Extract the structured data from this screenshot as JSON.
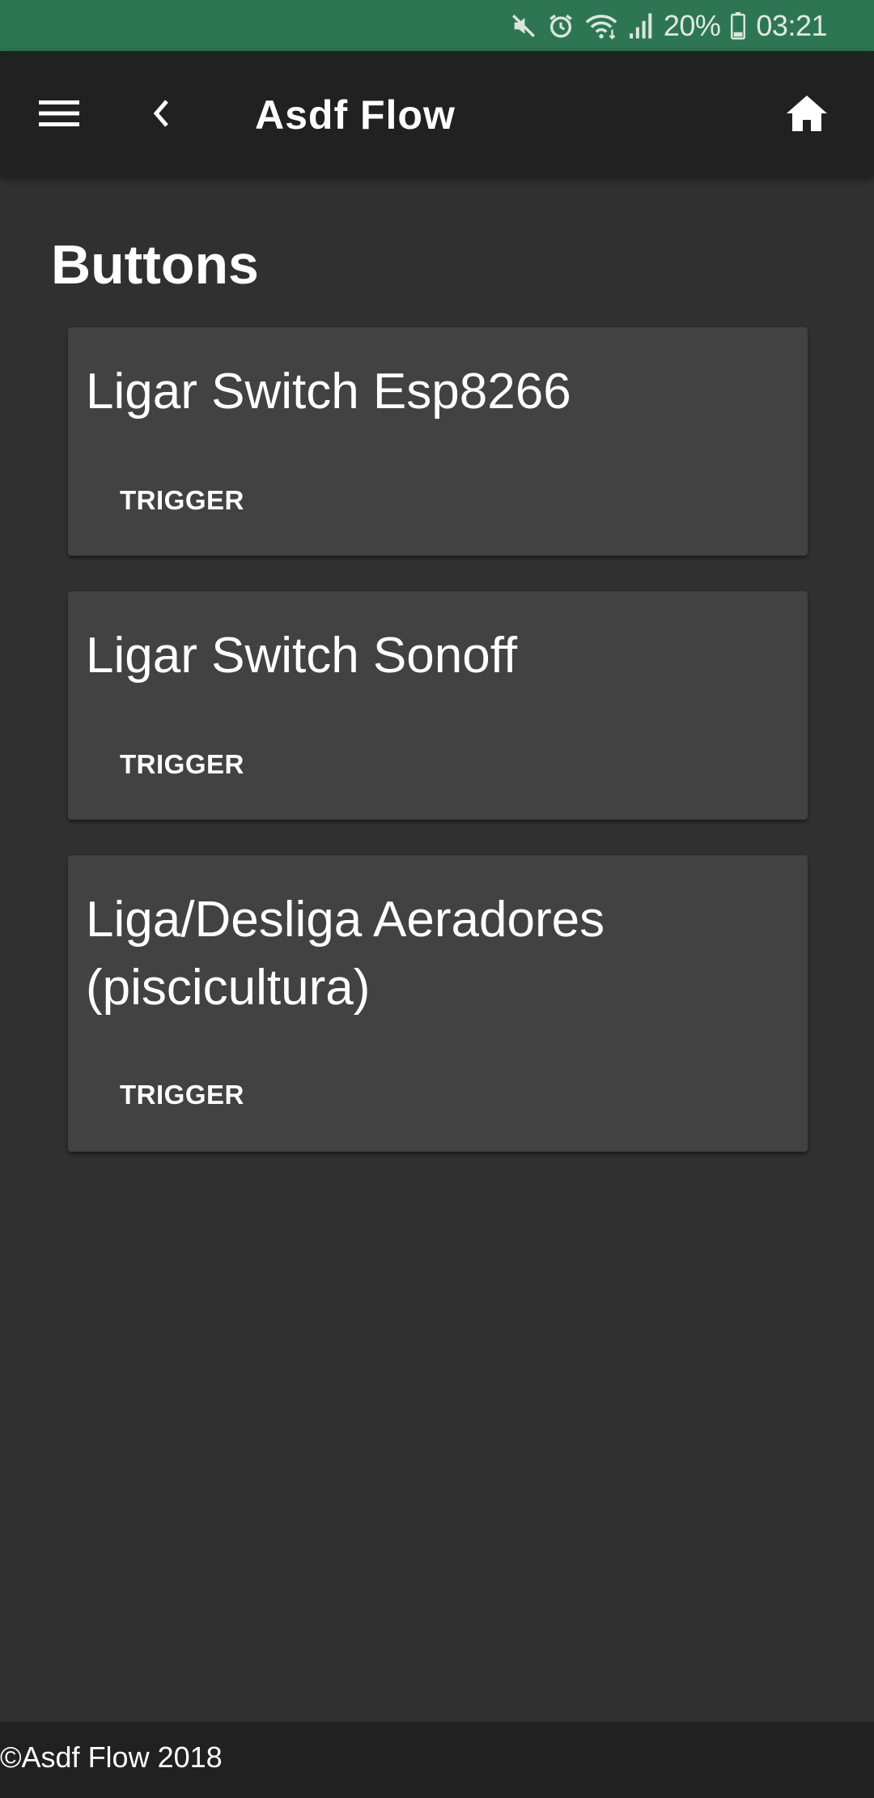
{
  "status_bar": {
    "battery": "20%",
    "time": "03:21",
    "icons": [
      "mute-icon",
      "alarm-icon",
      "wifi-icon",
      "signal-icon",
      "battery-icon"
    ]
  },
  "app_bar": {
    "title": "Asdf Flow",
    "icons": [
      "menu-icon",
      "back-chevron-icon",
      "home-icon"
    ]
  },
  "page": {
    "heading": "Buttons"
  },
  "cards": [
    {
      "title": "Ligar Switch Esp8266",
      "action": "TRIGGER"
    },
    {
      "title": "Ligar Switch Sonoff",
      "action": "TRIGGER"
    },
    {
      "title": "Liga/Desliga Aeradores (piscicultura)",
      "action": "TRIGGER"
    }
  ],
  "footer": {
    "text": "©Asdf Flow 2018"
  },
  "colors": {
    "status_bar": "#2e7653",
    "app_bar": "#212121",
    "background": "#303030",
    "card": "#424242"
  }
}
